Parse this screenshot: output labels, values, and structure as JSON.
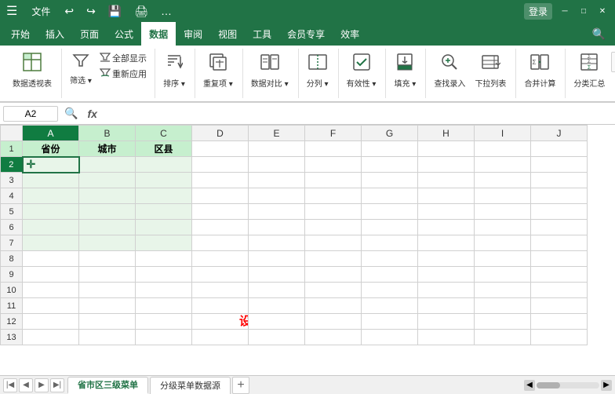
{
  "titlebar": {
    "menu_icon": "☰",
    "file_label": "文件",
    "title": "",
    "undo_icon": "↩",
    "redo_icon": "↪",
    "save_icon": "💾",
    "user_icon": "👤"
  },
  "ribbon": {
    "tabs": [
      {
        "label": "开始",
        "active": false
      },
      {
        "label": "插入",
        "active": false
      },
      {
        "label": "页面",
        "active": false
      },
      {
        "label": "公式",
        "active": false
      },
      {
        "label": "数据",
        "active": true
      },
      {
        "label": "审阅",
        "active": false
      },
      {
        "label": "视图",
        "active": false
      },
      {
        "label": "工具",
        "active": false
      },
      {
        "label": "会员专享",
        "active": false
      },
      {
        "label": "效率",
        "active": false
      }
    ],
    "groups": [
      {
        "name": "pivot",
        "items": [
          {
            "icon": "⊞",
            "label": "数据透视表"
          }
        ],
        "group_label": ""
      },
      {
        "name": "filter",
        "items": [
          {
            "icon": "▽",
            "label": "筛选▾"
          },
          {
            "icon": "",
            "label": "全部显示"
          },
          {
            "icon": "",
            "label": "重新应用"
          }
        ]
      },
      {
        "name": "sort",
        "items": [
          {
            "icon": "↕",
            "label": "排序▾"
          }
        ]
      },
      {
        "name": "duplicate",
        "items": [
          {
            "icon": "⧉",
            "label": "重复项▾"
          }
        ]
      },
      {
        "name": "compare",
        "items": [
          {
            "icon": "⇌",
            "label": "数据对比▾"
          }
        ]
      },
      {
        "name": "columns",
        "items": [
          {
            "icon": "⊟",
            "label": "分列▾"
          }
        ]
      },
      {
        "name": "validity",
        "items": [
          {
            "icon": "✓",
            "label": "有效性▾"
          }
        ]
      },
      {
        "name": "fill",
        "items": [
          {
            "icon": "⬇",
            "label": "填充▾"
          }
        ]
      },
      {
        "name": "findinsert",
        "items": [
          {
            "icon": "🔍",
            "label": "查找录入"
          },
          {
            "icon": "↕",
            "label": "下拉列表"
          }
        ]
      },
      {
        "name": "merge",
        "items": [
          {
            "icon": "⊞",
            "label": "合并计算"
          }
        ]
      },
      {
        "name": "subtotal",
        "items": [
          {
            "icon": "Σ",
            "label": "分类汇总"
          }
        ]
      }
    ]
  },
  "formula_bar": {
    "cell_ref": "A2",
    "search_icon": "🔍",
    "fx_icon": "fx",
    "formula_value": ""
  },
  "sheet": {
    "col_headers": [
      "",
      "A",
      "B",
      "C",
      "D",
      "E",
      "F",
      "G",
      "H",
      "I",
      "J"
    ],
    "rows": [
      {
        "row_num": "1",
        "cells": [
          "省份",
          "城市",
          "区县",
          "",
          "",
          "",
          "",
          "",
          "",
          ""
        ]
      },
      {
        "row_num": "2",
        "cells": [
          "",
          "",
          "",
          "",
          "",
          "",
          "",
          "",
          "",
          ""
        ]
      },
      {
        "row_num": "3",
        "cells": [
          "",
          "",
          "",
          "",
          "",
          "",
          "",
          "",
          "",
          ""
        ]
      },
      {
        "row_num": "4",
        "cells": [
          "",
          "",
          "",
          "",
          "",
          "",
          "",
          "",
          "",
          ""
        ]
      },
      {
        "row_num": "5",
        "cells": [
          "",
          "",
          "",
          "",
          "",
          "",
          "",
          "",
          "",
          ""
        ]
      },
      {
        "row_num": "6",
        "cells": [
          "",
          "",
          "",
          "",
          "",
          "",
          "",
          "",
          "",
          ""
        ]
      },
      {
        "row_num": "7",
        "cells": [
          "",
          "",
          "",
          "",
          "",
          "",
          "",
          "",
          "",
          ""
        ]
      },
      {
        "row_num": "8",
        "cells": [
          "",
          "",
          "",
          "",
          "",
          "",
          "",
          "",
          "",
          ""
        ]
      },
      {
        "row_num": "9",
        "cells": [
          "",
          "",
          "",
          "",
          "",
          "",
          "",
          "",
          "",
          ""
        ]
      },
      {
        "row_num": "10",
        "cells": [
          "",
          "",
          "",
          "",
          "",
          "",
          "",
          "",
          "",
          ""
        ]
      },
      {
        "row_num": "11",
        "cells": [
          "",
          "",
          "",
          "",
          "",
          "",
          "",
          "",
          "",
          ""
        ]
      },
      {
        "row_num": "12",
        "cells": [
          "",
          "",
          "",
          "",
          "",
          "",
          "",
          "",
          "",
          ""
        ]
      },
      {
        "row_num": "13",
        "cells": [
          "",
          "",
          "",
          "",
          "",
          "",
          "",
          "",
          "",
          ""
        ]
      }
    ],
    "annotation": "设置省份一级菜单",
    "annotation_col": 4,
    "annotation_row": 12
  },
  "sheet_tabs": {
    "tabs": [
      {
        "label": "省市区三级菜单",
        "active": true
      },
      {
        "label": "分级菜单数据源",
        "active": false
      }
    ],
    "add_label": "+"
  }
}
